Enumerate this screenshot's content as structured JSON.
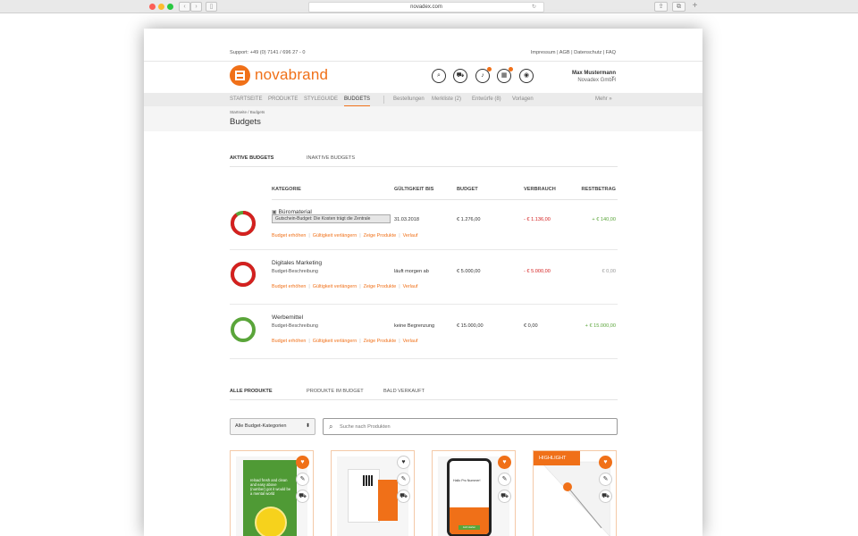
{
  "browser": {
    "url": "novadex.com",
    "reload_glyph": "↻",
    "back_glyph": "‹",
    "forward_glyph": "›",
    "sidebar_glyph": "▯",
    "share_glyph": "⇪",
    "tabs_glyph": "⧉",
    "newtab_glyph": "+"
  },
  "topbar": {
    "support": "Support: +49 (0) 7141 / 696 27 - 0",
    "links": "Impressum  |  AGB  |  Datenschutz  |  FAQ"
  },
  "header": {
    "logo_text": "novabrand",
    "search_glyph": "⌕",
    "cart_glyph": "⛟",
    "bell_glyph": "♪",
    "calendar_glyph": "▦",
    "account_glyph": "◉",
    "user_name": "Max Mustermann",
    "company": "Novadex GmbH",
    "chevron": "⌄"
  },
  "nav": {
    "items": [
      "STARTSEITE",
      "PRODUKTE",
      "STYLEGUIDE",
      "BUDGETS"
    ],
    "secondary": [
      "Bestellungen",
      "Merkliste (2)",
      "Entwürfe (8)",
      "Vorlagen"
    ],
    "more": "Mehr  »"
  },
  "page": {
    "breadcrumb": "Startseite / Budgets",
    "title": "Budgets"
  },
  "budget_tabs": [
    "AKTIVE BUDGETS",
    "INAKTIVE BUDGETS"
  ],
  "table": {
    "headers": [
      "KATEGORIE",
      "GÜLTIGKEIT BIS",
      "BUDGET",
      "VERBRAUCH",
      "RESTBETRAG"
    ],
    "rows": [
      {
        "category": "Büromaterial",
        "tooltip": "Gutschein-Budget: Die Kosten trägt die Zentrale",
        "validity": "31.03.2018",
        "budget": "€ 1.276,00",
        "usage": "- € 1.136,00",
        "rest": "+ € 140,00",
        "used_fraction": 0.89,
        "actions": [
          "Budget erhöhen",
          "Gültigkeit verlängern",
          "Zeige Produkte",
          "Verlauf"
        ]
      },
      {
        "category": "Digitales Marketing",
        "description": "Budget-Beschreibung",
        "validity": "läuft morgen ab",
        "budget": "€ 5.000,00",
        "usage": "- € 5.000,00",
        "rest": "€ 0,00",
        "used_fraction": 1.0,
        "actions": [
          "Budget erhöhen",
          "Gültigkeit verlängern",
          "Zeige Produkte",
          "Verlauf"
        ]
      },
      {
        "category": "Werbemittel",
        "description": "Budget-Beschreibung",
        "validity": "keine Begrenzung",
        "budget": "€ 15.000,00",
        "usage": "€ 0,00",
        "rest": "+ € 15.000,00",
        "used_fraction": 0.0,
        "actions": [
          "Budget erhöhen",
          "Gültigkeit verlängern",
          "Zeige Produkte",
          "Verlauf"
        ]
      }
    ]
  },
  "product_tabs": [
    "ALLE PRODUKTE",
    "PRODUKTE IM BUDGET",
    "BALD VERKAUFT"
  ],
  "filter": {
    "category_select": "Alle Budget-Kategorien",
    "select_arrow": "⬍",
    "search_placeholder": "Suche nach Produkten",
    "search_glyph": "⌕"
  },
  "products": [
    {
      "poster_text": "reload fresh and clean and easy above (number) got it would be a mental world",
      "highlight": ""
    },
    {
      "poster_text": "",
      "highlight": ""
    },
    {
      "poster_text": "Hallo Pro Nummer!",
      "button": "Jetzt starten",
      "highlight": ""
    },
    {
      "poster_text": "",
      "highlight": "HIGHLIGHT"
    }
  ],
  "product_action_glyphs": {
    "fav": "♥",
    "edit": "✎",
    "cart": "⛟"
  },
  "colors": {
    "accent": "#f07018",
    "red": "#d42020",
    "green": "#5aa53a"
  }
}
